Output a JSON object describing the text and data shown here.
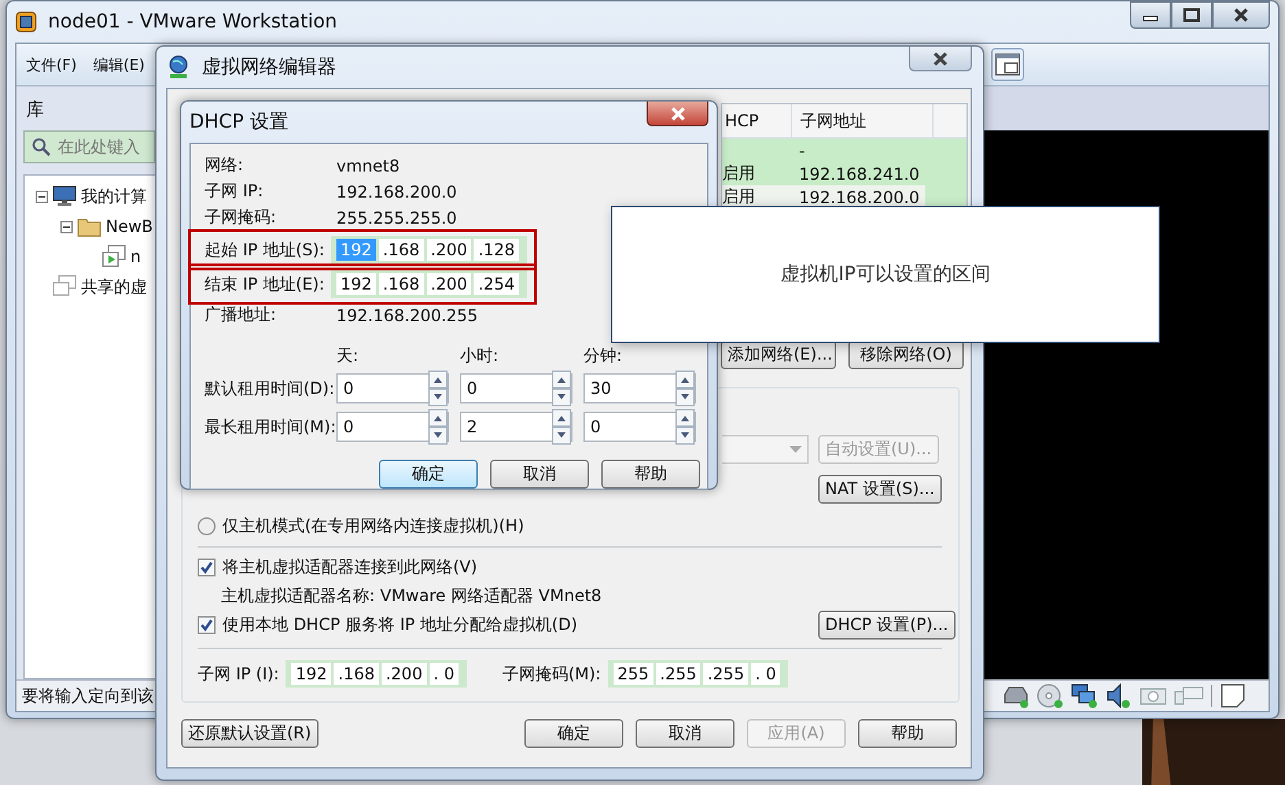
{
  "main_window": {
    "title": "node01 - VMware Workstation",
    "menu": [
      {
        "label": "文件(F)"
      },
      {
        "label": "编辑(E)"
      }
    ],
    "library": {
      "title": "库",
      "search": {
        "placeholder": "在此处键入"
      },
      "tree": [
        {
          "kind": "computer",
          "label": "我的计算",
          "expanded": true,
          "children": [
            {
              "kind": "folder",
              "label": "NewB",
              "expanded": true,
              "children": [
                {
                  "kind": "vm",
                  "label": "n"
                }
              ]
            }
          ]
        },
        {
          "kind": "shared",
          "label": "共享的虚"
        }
      ]
    },
    "status_text": "要将输入定向到该"
  },
  "network_editor": {
    "title": "虚拟网络编辑器",
    "table": {
      "columns": [
        "HCP",
        "子网地址"
      ],
      "rows": [
        {
          "subnet": "-",
          "selected": false
        },
        {
          "dhcp": "启用",
          "subnet": "192.168.241.0",
          "selected": false
        },
        {
          "dhcp": "启用",
          "subnet": "192.168.200.0",
          "selected": true
        }
      ]
    },
    "network_buttons": [
      {
        "label": "添加网络(E)..."
      },
      {
        "label": "移除网络(O)"
      }
    ],
    "dropdown": {
      "disabled": true
    },
    "auto_button": {
      "label": "自动设置(U)...",
      "disabled": true
    },
    "nat_button": {
      "label": "NAT 设置(S)...",
      "disabled": false
    },
    "host_only": {
      "label": "仅主机模式(在专用网络内连接虚拟机)(H)",
      "selected": false
    },
    "connect_adapter": {
      "label": "将主机虚拟适配器连接到此网络(V)",
      "checked": true
    },
    "adapter_name": "主机虚拟适配器名称: VMware 网络适配器 VMnet8",
    "use_dhcp": {
      "label": "使用本地 DHCP 服务将 IP 地址分配给虚拟机(D)",
      "checked": true
    },
    "dhcp_button": {
      "label": "DHCP 设置(P)...",
      "disabled": false
    },
    "subnet_ip": {
      "label": "子网 IP (I):",
      "octets": [
        {
          "text": "192",
          "selected": false
        },
        {
          "text": ".168",
          "selected": false
        },
        {
          "text": ".200",
          "selected": false
        },
        {
          "text": ". 0",
          "selected": false
        }
      ]
    },
    "subnet_mask": {
      "label": "子网掩码(M):",
      "octets": [
        {
          "text": "255",
          "selected": false
        },
        {
          "text": ".255",
          "selected": false
        },
        {
          "text": ".255",
          "selected": false
        },
        {
          "text": ". 0",
          "selected": false
        }
      ]
    },
    "buttons": [
      {
        "label": "还原默认设置(R)",
        "disabled": false
      },
      {
        "label": "确定",
        "disabled": false
      },
      {
        "label": "取消",
        "disabled": false
      },
      {
        "label": "应用(A)",
        "disabled": true
      },
      {
        "label": "帮助",
        "disabled": false
      }
    ]
  },
  "dhcp_dialog": {
    "title": "DHCP 设置",
    "info": [
      {
        "label": "网络:",
        "value": "vmnet8"
      },
      {
        "label": "子网 IP:",
        "value": "192.168.200.0"
      },
      {
        "label": "子网掩码:",
        "value": "255.255.255.0"
      }
    ],
    "range": [
      {
        "label": "起始 IP 地址(S):",
        "marked": true,
        "octets": [
          {
            "text": "192",
            "selected": true
          },
          {
            "text": ".168",
            "selected": false
          },
          {
            "text": ".200",
            "selected": false
          },
          {
            "text": ".128",
            "selected": false
          }
        ]
      },
      {
        "label": "结束 IP 地址(E):",
        "marked": true,
        "octets": [
          {
            "text": "192",
            "selected": false
          },
          {
            "text": ".168",
            "selected": false
          },
          {
            "text": ".200",
            "selected": false
          },
          {
            "text": ".254",
            "selected": false
          }
        ]
      }
    ],
    "broadcast": {
      "label": "广播地址:",
      "value": "192.168.200.255"
    },
    "lease_units": [
      "天:",
      "小时:",
      "分钟:"
    ],
    "leases": [
      {
        "label": "默认租用时间(D):",
        "values": [
          "0",
          "0",
          "30"
        ]
      },
      {
        "label": "最长租用时间(M):",
        "values": [
          "0",
          "2",
          "0"
        ]
      }
    ],
    "buttons": [
      {
        "label": "确定",
        "default": true
      },
      {
        "label": "取消",
        "default": false
      },
      {
        "label": "帮助",
        "default": false
      }
    ]
  },
  "callout": {
    "text": "虚拟机IP可以设置的区间"
  }
}
